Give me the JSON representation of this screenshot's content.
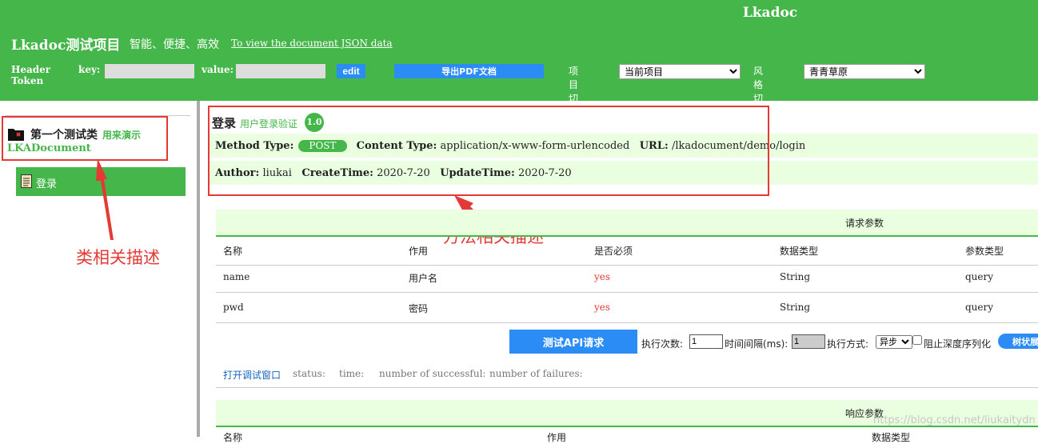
{
  "header": {
    "app_name": "Lkadoc",
    "project_title": "Lkadoc测试项目",
    "project_slogan": "智能、便捷、高效",
    "json_link": "To view the document JSON data",
    "token_label": "Header Token",
    "key_label": "key:",
    "value_label": "value:",
    "key_value": "",
    "value_value": "",
    "edit_label": "edit",
    "pdf_label": "导出PDF文档",
    "project_switch_label": "项目切换:",
    "project_select": "当前项目",
    "style_switch_label": "风格切换:",
    "style_select": "青青草原"
  },
  "sidebar": {
    "class_title": "第一个测试类",
    "class_sub": "用来演示",
    "class_name": "LKADocument",
    "items": [
      {
        "label": "登录"
      }
    ]
  },
  "annotations": {
    "class_desc": "类相关描述",
    "method_desc": "方法相关描述"
  },
  "method": {
    "title": "登录",
    "subtitle": "用户登录验证",
    "version": "1.0",
    "method_type_label": "Method Type:",
    "method_type": "POST",
    "content_type_label": "Content Type:",
    "content_type": "application/x-www-form-urlencoded",
    "url_label": "URL:",
    "url": "/lkadocument/demo/login",
    "author_label": "Author:",
    "author": "liukai",
    "create_label": "CreateTime:",
    "create_time": "2020-7-20",
    "update_label": "UpdateTime:",
    "update_time": "2020-7-20"
  },
  "request": {
    "heading": "请求参数",
    "columns": [
      "名称",
      "作用",
      "是否必须",
      "数据类型",
      "参数类型"
    ],
    "rows": [
      [
        "name",
        "用户名",
        "yes",
        "String",
        "query"
      ],
      [
        "pwd",
        "密码",
        "yes",
        "String",
        "query"
      ]
    ]
  },
  "test": {
    "button": "测试API请求",
    "count_label": "执行次数:",
    "count_value": "1",
    "interval_label": "时间间隔(ms):",
    "interval_value": "1",
    "mode_label": "执行方式:",
    "mode_value": "异步",
    "deep_label": "阻止深度序列化",
    "tree_button": "树状展"
  },
  "status": {
    "debug_link": "打开调试窗口",
    "status_label": "status:",
    "time_label": "time:",
    "success_label": "number of successful:",
    "fail_label": "number of failures:"
  },
  "response": {
    "heading": "响应参数",
    "columns": [
      "名称",
      "作用",
      "数据类型"
    ]
  },
  "watermark": "https://blog.csdn.net/liukaitydn",
  "colors": {
    "green": "#45b649",
    "blue": "#2b8cf5",
    "red": "#e53935",
    "light_green": "#eaffe0"
  }
}
